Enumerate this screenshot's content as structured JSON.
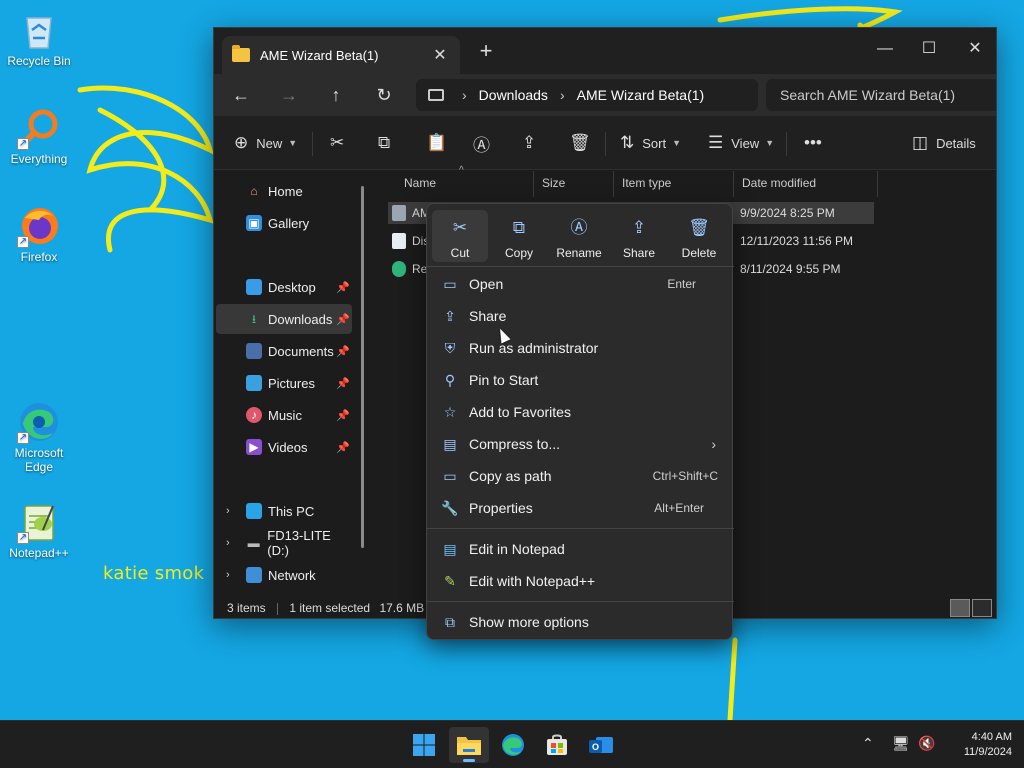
{
  "desktop": {
    "icons": [
      {
        "label": "Recycle Bin",
        "icon": "recycle-bin-icon"
      },
      {
        "label": "Everything",
        "icon": "everything-search-icon"
      },
      {
        "label": "Firefox",
        "icon": "firefox-icon"
      },
      {
        "label": "Microsoft Edge",
        "icon": "edge-icon"
      },
      {
        "label": "Notepad++",
        "icon": "notepadpp-icon"
      }
    ],
    "handwriting": "katie smok"
  },
  "window": {
    "tab_title": "AME Wizard Beta(1)",
    "breadcrumb": [
      "Downloads",
      "AME Wizard Beta(1)"
    ],
    "search_placeholder": "Search AME Wizard Beta(1)",
    "toolbar": {
      "new_label": "New",
      "sort_label": "Sort",
      "view_label": "View",
      "details_label": "Details"
    },
    "nav": [
      {
        "label": "Home",
        "icon": "home-icon"
      },
      {
        "label": "Gallery",
        "icon": "gallery-icon"
      },
      {
        "label": "Desktop",
        "icon": "desktop-icon"
      },
      {
        "label": "Downloads",
        "icon": "downloads-icon"
      },
      {
        "label": "Documents",
        "icon": "documents-icon"
      },
      {
        "label": "Pictures",
        "icon": "pictures-icon"
      },
      {
        "label": "Music",
        "icon": "music-icon"
      },
      {
        "label": "Videos",
        "icon": "videos-icon"
      },
      {
        "label": "This PC",
        "icon": "this-pc-icon"
      },
      {
        "label": "FD13-LITE (D:)",
        "icon": "drive-icon"
      },
      {
        "label": "Network",
        "icon": "network-icon"
      }
    ],
    "columns": [
      "Name",
      "Size",
      "Item type",
      "Date modified"
    ],
    "files": [
      {
        "name": "AM",
        "date": "9/9/2024 8:25 PM"
      },
      {
        "name": "Dis",
        "date": "12/11/2023 11:56 PM"
      },
      {
        "name": "Re",
        "date": "8/11/2024 9:55 PM"
      }
    ],
    "status": {
      "count": "3 items",
      "selection": "1 item selected",
      "size": "17.6 MB"
    }
  },
  "context_menu": {
    "quick_actions": [
      {
        "label": "Cut",
        "icon": "scissors-icon"
      },
      {
        "label": "Copy",
        "icon": "copy-icon"
      },
      {
        "label": "Rename",
        "icon": "rename-icon"
      },
      {
        "label": "Share",
        "icon": "share-icon"
      },
      {
        "label": "Delete",
        "icon": "trash-icon"
      }
    ],
    "items": [
      {
        "label": "Open",
        "accel": "Enter",
        "icon": "open-icon"
      },
      {
        "label": "Share",
        "accel": "",
        "icon": "share-icon"
      },
      {
        "label": "Run as administrator",
        "accel": "",
        "icon": "shield-icon"
      },
      {
        "label": "Pin to Start",
        "accel": "",
        "icon": "pin-icon"
      },
      {
        "label": "Add to Favorites",
        "accel": "",
        "icon": "star-icon"
      },
      {
        "label": "Compress to...",
        "accel": "",
        "icon": "archive-icon"
      },
      {
        "label": "Copy as path",
        "accel": "Ctrl+Shift+C",
        "icon": "path-icon"
      },
      {
        "label": "Properties",
        "accel": "Alt+Enter",
        "icon": "wrench-icon"
      },
      {
        "label": "Edit in Notepad",
        "accel": "",
        "icon": "notepad-icon"
      },
      {
        "label": "Edit with Notepad++",
        "accel": "",
        "icon": "notepadpp-icon"
      },
      {
        "label": "Show more options",
        "accel": "",
        "icon": "more-options-icon"
      }
    ]
  },
  "taskbar": {
    "apps": [
      "start-icon",
      "file-explorer-icon",
      "edge-icon",
      "store-icon",
      "outlook-icon"
    ],
    "time": "4:40 AM",
    "date": "11/9/2024"
  }
}
